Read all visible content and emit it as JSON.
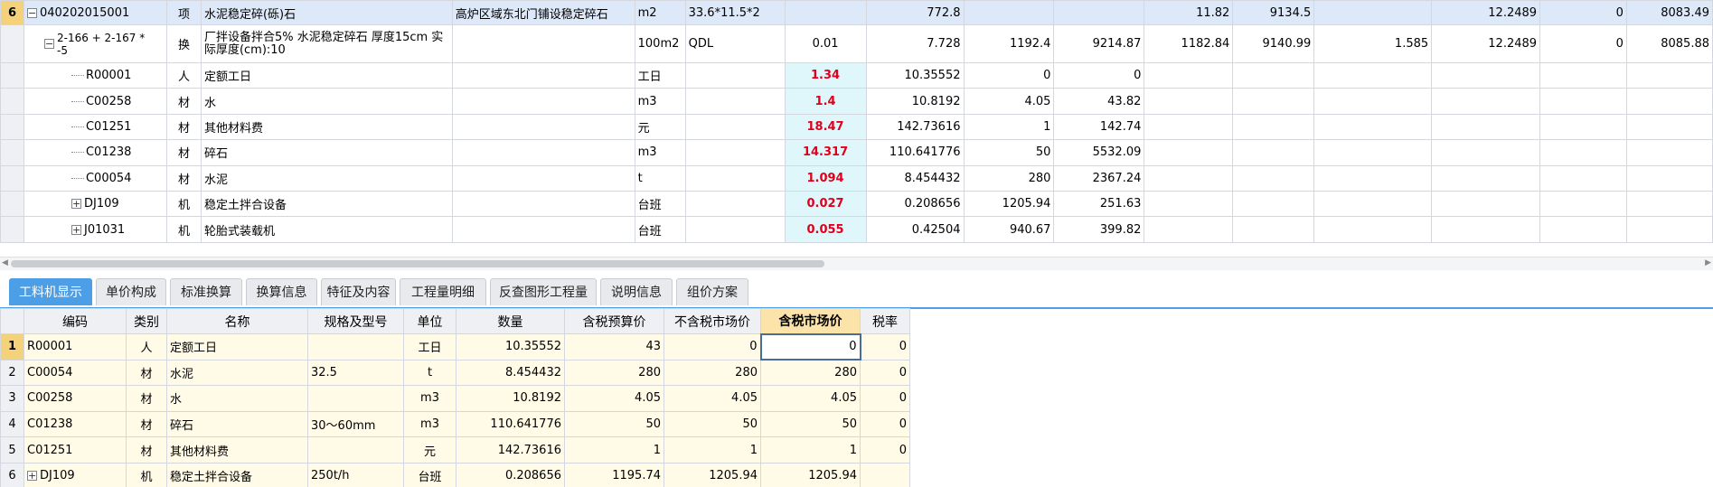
{
  "top_rows": [
    {
      "num": "6",
      "code": "040202015001",
      "type": "项",
      "name": "水泥稳定碎(砾)石",
      "spec": "高炉区域东北门铺设稳定碎石",
      "unit": "m2",
      "expr": "33.6*11.5*2",
      "qty": "",
      "amount": "772.8",
      "price": "",
      "total": "",
      "c1": "11.82",
      "c2": "9134.5",
      "c3": "",
      "c4": "12.2489",
      "c5": "0",
      "c6": "8083.49",
      "kind": "main"
    },
    {
      "num": "",
      "code": "2-166 + 2-167 * -5",
      "type": "换",
      "name": "厂拌设备拌合5% 水泥稳定碎石 厚度15cm 实际厚度(cm):10",
      "spec": "",
      "unit": "100m2",
      "expr": "QDL",
      "qty": "0.01",
      "amount": "7.728",
      "price": "1192.4",
      "total": "9214.87",
      "c1": "1182.84",
      "c2": "9140.99",
      "c3": "1.585",
      "c4": "12.2489",
      "c5": "0",
      "c6": "8085.88",
      "kind": "sub"
    },
    {
      "num": "",
      "code": "R00001",
      "type": "人",
      "name": "定额工日",
      "spec": "",
      "unit": "工日",
      "expr": "",
      "qty": "1.34",
      "amount": "10.35552",
      "price": "0",
      "total": "0",
      "c1": "",
      "c2": "",
      "c3": "",
      "c4": "",
      "c5": "",
      "c6": "",
      "kind": "item"
    },
    {
      "num": "",
      "code": "C00258",
      "type": "材",
      "name": "水",
      "spec": "",
      "unit": "m3",
      "expr": "",
      "qty": "1.4",
      "amount": "10.8192",
      "price": "4.05",
      "total": "43.82",
      "c1": "",
      "c2": "",
      "c3": "",
      "c4": "",
      "c5": "",
      "c6": "",
      "kind": "item"
    },
    {
      "num": "",
      "code": "C01251",
      "type": "材",
      "name": "其他材料费",
      "spec": "",
      "unit": "元",
      "expr": "",
      "qty": "18.47",
      "amount": "142.73616",
      "price": "1",
      "total": "142.74",
      "c1": "",
      "c2": "",
      "c3": "",
      "c4": "",
      "c5": "",
      "c6": "",
      "kind": "item"
    },
    {
      "num": "",
      "code": "C01238",
      "type": "材",
      "name": "碎石",
      "spec": "",
      "unit": "m3",
      "expr": "",
      "qty": "14.317",
      "amount": "110.641776",
      "price": "50",
      "total": "5532.09",
      "c1": "",
      "c2": "",
      "c3": "",
      "c4": "",
      "c5": "",
      "c6": "",
      "kind": "item"
    },
    {
      "num": "",
      "code": "C00054",
      "type": "材",
      "name": "水泥",
      "spec": "",
      "unit": "t",
      "expr": "",
      "qty": "1.094",
      "amount": "8.454432",
      "price": "280",
      "total": "2367.24",
      "c1": "",
      "c2": "",
      "c3": "",
      "c4": "",
      "c5": "",
      "c6": "",
      "kind": "item"
    },
    {
      "num": "",
      "code": "DJ109",
      "type": "机",
      "name": "稳定土拌合设备",
      "spec": "",
      "unit": "台班",
      "expr": "",
      "qty": "0.027",
      "amount": "0.208656",
      "price": "1205.94",
      "total": "251.63",
      "c1": "",
      "c2": "",
      "c3": "",
      "c4": "",
      "c5": "",
      "c6": "",
      "kind": "expand"
    },
    {
      "num": "",
      "code": "J01031",
      "type": "机",
      "name": "轮胎式装载机",
      "spec": "",
      "unit": "台班",
      "expr": "",
      "qty": "0.055",
      "amount": "0.42504",
      "price": "940.67",
      "total": "399.82",
      "c1": "",
      "c2": "",
      "c3": "",
      "c4": "",
      "c5": "",
      "c6": "",
      "kind": "expand"
    }
  ],
  "tabs": [
    "工料机显示",
    "单价构成",
    "标准换算",
    "换算信息",
    "特征及内容",
    "工程量明细",
    "反查图形工程量",
    "说明信息",
    "组价方案"
  ],
  "bottom_headers": [
    "",
    "编码",
    "类别",
    "名称",
    "规格及型号",
    "单位",
    "数量",
    "含税预算价",
    "不含税市场价",
    "含税市场价",
    "税率"
  ],
  "bottom_rows": [
    {
      "n": "1",
      "code": "R00001",
      "type": "人",
      "name": "定额工日",
      "spec": "",
      "unit": "工日",
      "qty": "10.35552",
      "p1": "43",
      "p2": "0",
      "p3": "0",
      "tax": "0"
    },
    {
      "n": "2",
      "code": "C00054",
      "type": "材",
      "name": "水泥",
      "spec": "32.5",
      "unit": "t",
      "qty": "8.454432",
      "p1": "280",
      "p2": "280",
      "p3": "280",
      "tax": "0"
    },
    {
      "n": "3",
      "code": "C00258",
      "type": "材",
      "name": "水",
      "spec": "",
      "unit": "m3",
      "qty": "10.8192",
      "p1": "4.05",
      "p2": "4.05",
      "p3": "4.05",
      "tax": "0"
    },
    {
      "n": "4",
      "code": "C01238",
      "type": "材",
      "name": "碎石",
      "spec": "30～60mm",
      "unit": "m3",
      "qty": "110.641776",
      "p1": "50",
      "p2": "50",
      "p3": "50",
      "tax": "0"
    },
    {
      "n": "5",
      "code": "C01251",
      "type": "材",
      "name": "其他材料费",
      "spec": "",
      "unit": "元",
      "qty": "142.73616",
      "p1": "1",
      "p2": "1",
      "p3": "1",
      "tax": "0"
    },
    {
      "n": "6",
      "code": "DJ109",
      "type": "机",
      "name": "稳定土拌合设备",
      "spec": "250t/h",
      "unit": "台班",
      "qty": "0.208656",
      "p1": "1195.74",
      "p2": "1205.94",
      "p3": "1205.94",
      "tax": ""
    }
  ],
  "colors": {
    "accent": "#4c9ee6",
    "red": "#e0001b",
    "highlight": "#f4d27c"
  }
}
